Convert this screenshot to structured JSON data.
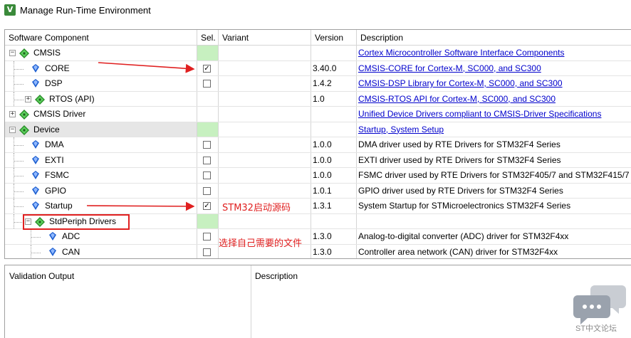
{
  "window": {
    "title": "Manage Run-Time Environment",
    "icon": "keil-app-icon"
  },
  "columns": {
    "component": "Software Component",
    "sel": "Sel.",
    "variant": "Variant",
    "version": "Version",
    "description": "Description"
  },
  "rows": [
    {
      "name": "CMSIS",
      "level": 0,
      "expander": "minus",
      "icon": "diamond",
      "green": true,
      "checkbox": false,
      "checked": false,
      "version": "",
      "description": "Cortex Microcontroller Software Interface Components",
      "link": true
    },
    {
      "name": "CORE",
      "level": 1,
      "expander": "",
      "icon": "gem",
      "green": false,
      "checkbox": true,
      "checked": true,
      "version": "3.40.0",
      "description": "CMSIS-CORE for Cortex-M, SC000, and SC300",
      "link": true
    },
    {
      "name": "DSP",
      "level": 1,
      "expander": "",
      "icon": "gem",
      "green": false,
      "checkbox": true,
      "checked": false,
      "version": "1.4.2",
      "description": "CMSIS-DSP Library for Cortex-M, SC000, and SC300",
      "link": true
    },
    {
      "name": "RTOS (API)",
      "level": 1,
      "expander": "plus",
      "icon": "diamond",
      "green": false,
      "checkbox": false,
      "checked": false,
      "version": "1.0",
      "description": "CMSIS-RTOS API for Cortex-M, SC000, and SC300",
      "link": true
    },
    {
      "name": "CMSIS Driver",
      "level": 0,
      "expander": "plus",
      "icon": "diamond",
      "green": false,
      "checkbox": false,
      "checked": false,
      "version": "",
      "description": "Unified Device Drivers compliant to CMSIS-Driver Specifications",
      "link": true
    },
    {
      "name": "Device",
      "level": 0,
      "expander": "minus",
      "icon": "diamond",
      "green": true,
      "checkbox": false,
      "checked": false,
      "version": "",
      "description": "Startup, System Setup",
      "link": true,
      "selected": true
    },
    {
      "name": "DMA",
      "level": 1,
      "expander": "",
      "icon": "gem",
      "green": false,
      "checkbox": true,
      "checked": false,
      "version": "1.0.0",
      "description": "DMA driver used by RTE Drivers for STM32F4 Series",
      "link": false
    },
    {
      "name": "EXTI",
      "level": 1,
      "expander": "",
      "icon": "gem",
      "green": false,
      "checkbox": true,
      "checked": false,
      "version": "1.0.0",
      "description": "EXTI driver used by RTE Drivers for STM32F4 Series",
      "link": false
    },
    {
      "name": "FSMC",
      "level": 1,
      "expander": "",
      "icon": "gem",
      "green": false,
      "checkbox": true,
      "checked": false,
      "version": "1.0.0",
      "description": "FSMC driver used by RTE Drivers for STM32F405/7 and STM32F415/7",
      "link": false
    },
    {
      "name": "GPIO",
      "level": 1,
      "expander": "",
      "icon": "gem",
      "green": false,
      "checkbox": true,
      "checked": false,
      "version": "1.0.1",
      "description": "GPIO driver used by RTE Drivers for STM32F4 Series",
      "link": false
    },
    {
      "name": "Startup",
      "level": 1,
      "expander": "",
      "icon": "gem",
      "green": false,
      "checkbox": true,
      "checked": true,
      "version": "1.3.1",
      "description": "System Startup for STMicroelectronics STM32F4 Series",
      "link": false
    },
    {
      "name": "StdPeriph Drivers",
      "level": 1,
      "expander": "minus",
      "icon": "diamond",
      "green": true,
      "checkbox": false,
      "checked": false,
      "version": "",
      "description": "",
      "link": false
    },
    {
      "name": "ADC",
      "level": 2,
      "expander": "",
      "icon": "gem",
      "green": false,
      "checkbox": true,
      "checked": false,
      "version": "1.3.0",
      "description": "Analog-to-digital converter (ADC) driver for STM32F4xx",
      "link": false
    },
    {
      "name": "CAN",
      "level": 2,
      "expander": "",
      "icon": "gem",
      "green": false,
      "checkbox": true,
      "checked": false,
      "version": "1.3.0",
      "description": "Controller area network (CAN) driver for STM32F4xx",
      "link": false
    }
  ],
  "annotations": {
    "startup_note": "STM32启动源码",
    "select_note": "选择自己需要的文件"
  },
  "bottom": {
    "validation_output": "Validation Output",
    "description": "Description"
  },
  "watermark": {
    "text": "ST中文论坛"
  },
  "colors": {
    "selected_green": "#c7f0c0",
    "link_blue": "#0000cc",
    "annotation_red": "#e02020"
  }
}
